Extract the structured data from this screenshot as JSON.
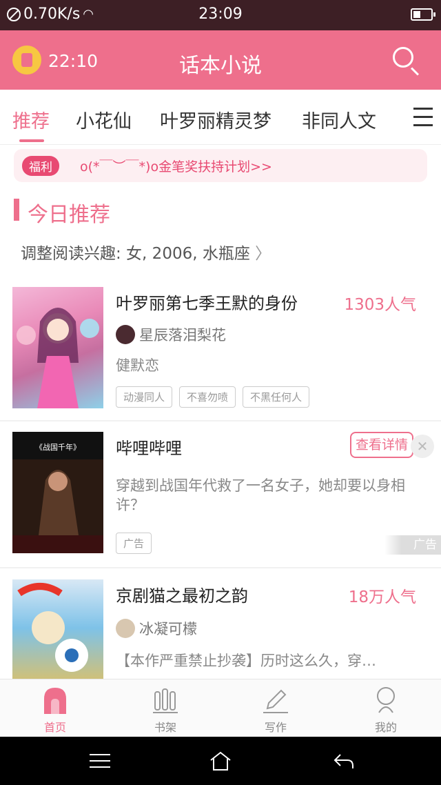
{
  "status_bar": {
    "speed": "0.70K/s",
    "time": "23:09"
  },
  "header": {
    "alarm_time": "22:10",
    "title": "话本小说"
  },
  "tabs": [
    {
      "label": "推荐",
      "active": true
    },
    {
      "label": "小花仙"
    },
    {
      "label": "叶罗丽精灵梦"
    },
    {
      "label": "非同人文"
    },
    {
      "label": "目"
    }
  ],
  "promo": {
    "badge": "福利",
    "text": "o(*￣︶￣*)o金笔奖扶持计划>>"
  },
  "section": {
    "title": "今日推荐",
    "interest": "调整阅读兴趣: 女, 2006, 水瓶座"
  },
  "books": [
    {
      "title": "叶罗丽第七季王默的身份",
      "popularity": "1303人气",
      "author": "星辰落泪梨花",
      "description": "健默恋",
      "tags": [
        "动漫同人",
        "不喜勿喷",
        "不黑任何人"
      ]
    },
    {
      "title": "京剧猫之最初之韵",
      "popularity": "18万人气",
      "author": "冰凝可檬",
      "description": "【本作严重禁止抄袭】历时这么久，穿…"
    }
  ],
  "ad": {
    "title": "哔哩哔哩",
    "button": "查看详情",
    "description": "穿越到战国年代救了一名女子，她却要以身相许？",
    "tag": "广告",
    "mark": "广告",
    "cover_text": "《战国千年》"
  },
  "bottom_nav": [
    {
      "label": "首页",
      "icon": "home-icon",
      "active": true
    },
    {
      "label": "书架",
      "icon": "bookshelf-icon"
    },
    {
      "label": "写作",
      "icon": "pencil-icon"
    },
    {
      "label": "我的",
      "icon": "profile-icon"
    }
  ],
  "colors": {
    "accent": "#ee6f8c",
    "header": "#ee6f8c",
    "status_bar": "#3d1f25"
  }
}
